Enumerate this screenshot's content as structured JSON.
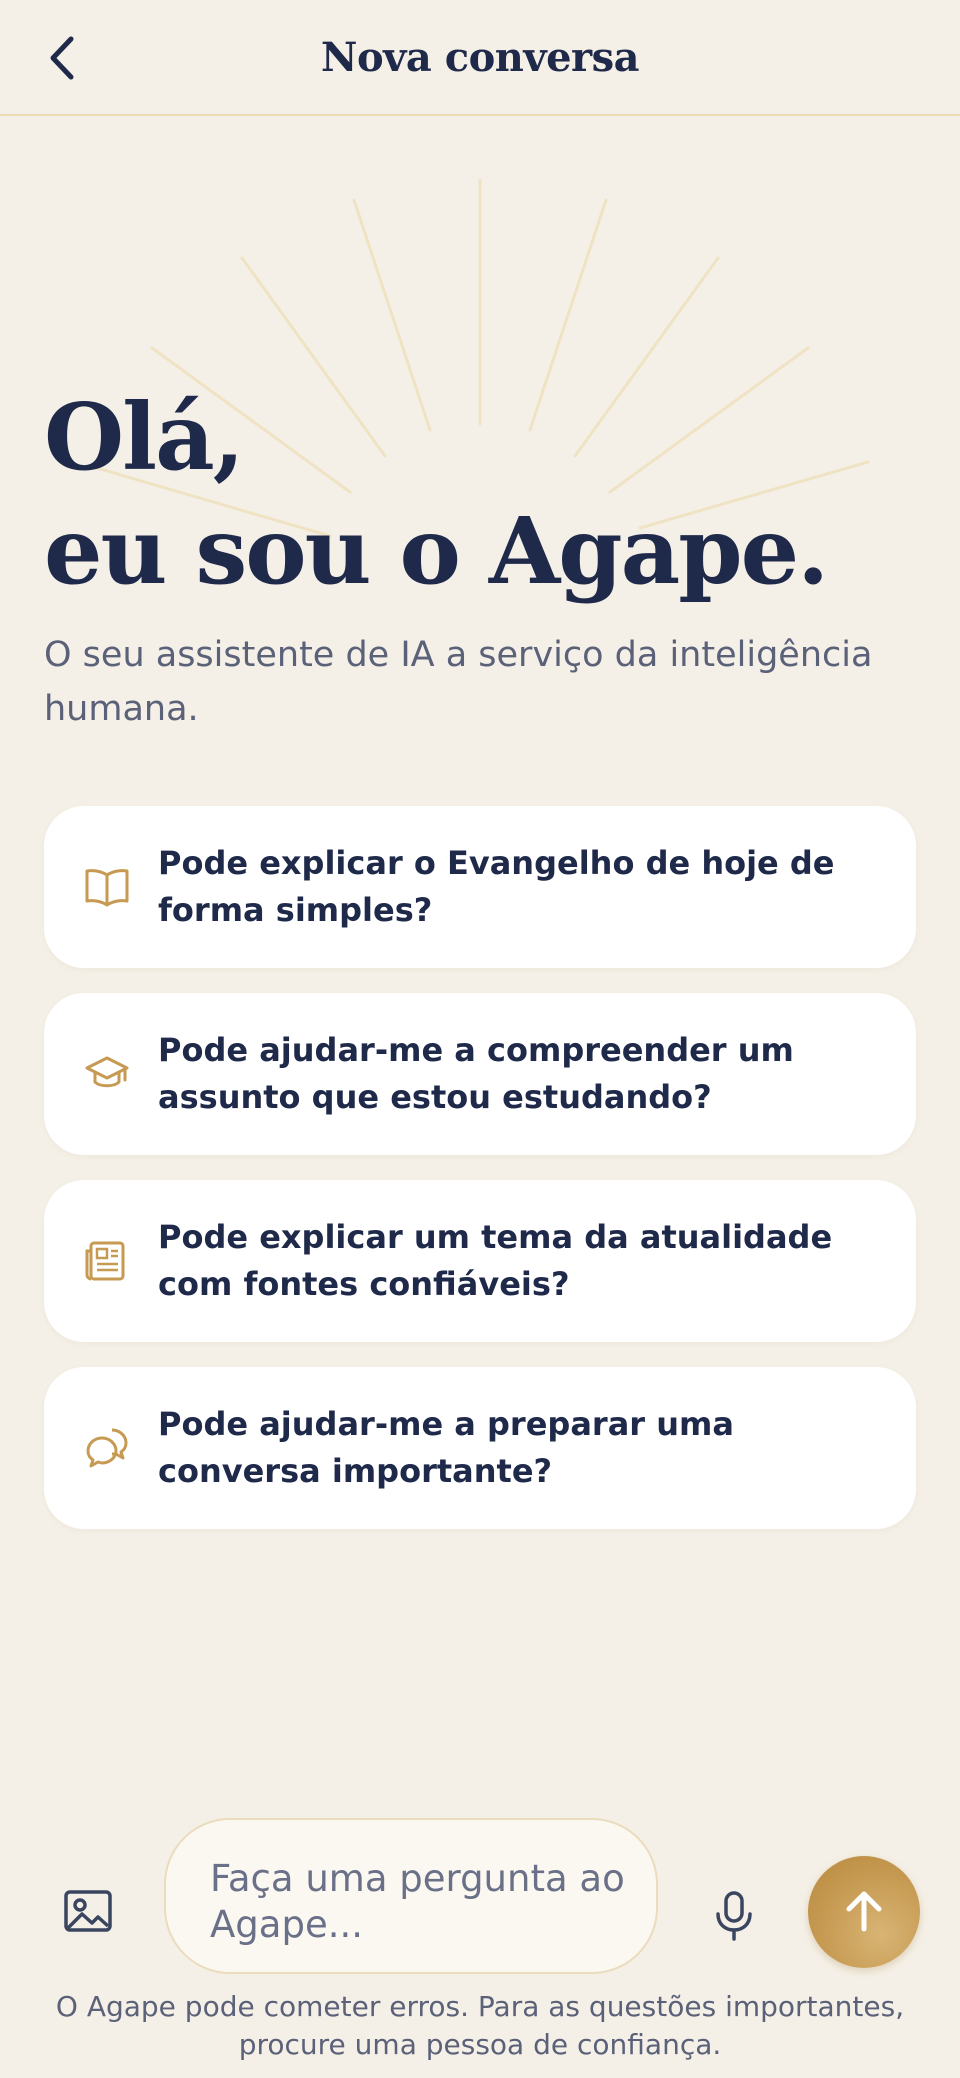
{
  "header": {
    "back_icon": "chevron-left-icon",
    "title": "Nova conversa"
  },
  "hero": {
    "title_line1": "Olá,",
    "title_line2": "eu sou o Agape.",
    "subtitle": "O seu assistente de IA a serviço da inteligência humana."
  },
  "suggestions": [
    {
      "icon": "book-open-icon",
      "text": "Pode explicar o Evangelho de hoje de forma simples?"
    },
    {
      "icon": "graduation-cap-icon",
      "text": "Pode ajudar-me a compreender um assunto que estou estudando?"
    },
    {
      "icon": "newspaper-icon",
      "text": "Pode explicar um tema da atualidade com fontes confiáveis?"
    },
    {
      "icon": "chat-bubbles-icon",
      "text": "Pode ajudar-me a preparar uma conversa importante?"
    }
  ],
  "composer": {
    "image_icon": "image-icon",
    "placeholder": "Faça uma pergunta ao Agape...",
    "mic_icon": "microphone-icon",
    "send_icon": "arrow-up-icon"
  },
  "disclaimer": "O Agape pode cometer erros. Para as questões importantes, procure uma pessoa de confiança.",
  "colors": {
    "background": "#f5f0e7",
    "navy": "#1f2a4a",
    "gold": "#c69a52",
    "muted": "#5b6178",
    "card": "#ffffff"
  }
}
